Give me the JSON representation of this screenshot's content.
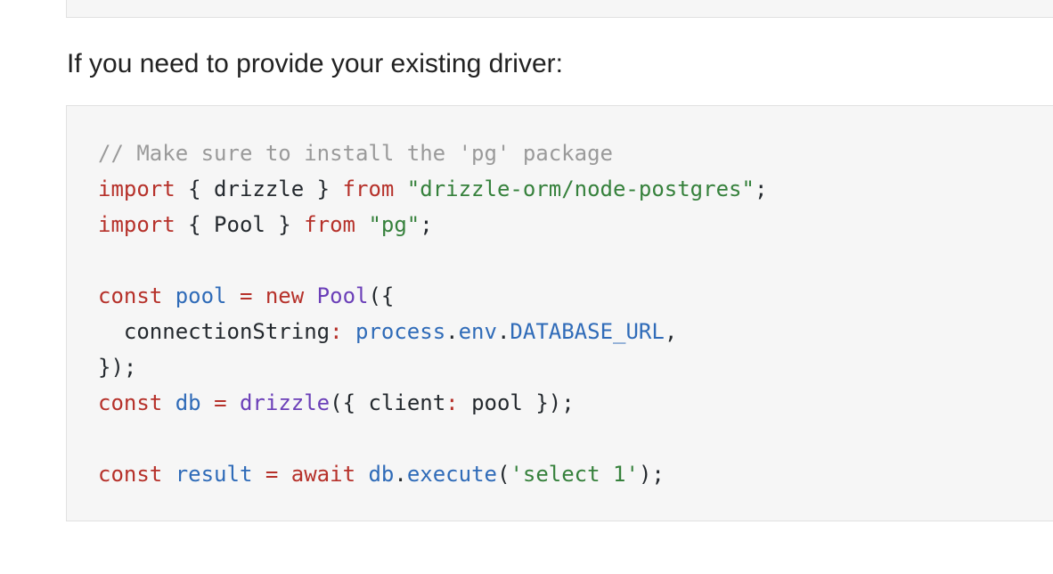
{
  "paragraph": {
    "text": "If you need to provide your existing driver:"
  },
  "colors": {
    "keyword": "#b6312a",
    "string": "#36813c",
    "variable": "#2f6bb8",
    "function": "#6b3fb8",
    "comment": "#9a9a9a",
    "plain": "#24292e",
    "code_background": "#f6f6f6"
  },
  "code": {
    "lines": [
      [
        {
          "t": "comment",
          "v": "// Make sure to install the 'pg' package"
        }
      ],
      [
        {
          "t": "kw",
          "v": "import"
        },
        {
          "t": "plain",
          "v": " { drizzle } "
        },
        {
          "t": "kw",
          "v": "from"
        },
        {
          "t": "plain",
          "v": " "
        },
        {
          "t": "str",
          "v": "\"drizzle-orm/node-postgres\""
        },
        {
          "t": "plain",
          "v": ";"
        }
      ],
      [
        {
          "t": "kw",
          "v": "import"
        },
        {
          "t": "plain",
          "v": " { Pool } "
        },
        {
          "t": "kw",
          "v": "from"
        },
        {
          "t": "plain",
          "v": " "
        },
        {
          "t": "str",
          "v": "\"pg\""
        },
        {
          "t": "plain",
          "v": ";"
        }
      ],
      [
        {
          "t": "plain",
          "v": ""
        }
      ],
      [
        {
          "t": "kw",
          "v": "const"
        },
        {
          "t": "plain",
          "v": " "
        },
        {
          "t": "var",
          "v": "pool"
        },
        {
          "t": "plain",
          "v": " "
        },
        {
          "t": "op",
          "v": "="
        },
        {
          "t": "plain",
          "v": " "
        },
        {
          "t": "kw",
          "v": "new"
        },
        {
          "t": "plain",
          "v": " "
        },
        {
          "t": "fn",
          "v": "Pool"
        },
        {
          "t": "plain",
          "v": "({"
        }
      ],
      [
        {
          "t": "plain",
          "v": "  connectionString"
        },
        {
          "t": "op",
          "v": ":"
        },
        {
          "t": "plain",
          "v": " "
        },
        {
          "t": "var",
          "v": "process"
        },
        {
          "t": "plain",
          "v": "."
        },
        {
          "t": "var",
          "v": "env"
        },
        {
          "t": "plain",
          "v": "."
        },
        {
          "t": "var",
          "v": "DATABASE_URL"
        },
        {
          "t": "plain",
          "v": ","
        }
      ],
      [
        {
          "t": "plain",
          "v": "});"
        }
      ],
      [
        {
          "t": "kw",
          "v": "const"
        },
        {
          "t": "plain",
          "v": " "
        },
        {
          "t": "var",
          "v": "db"
        },
        {
          "t": "plain",
          "v": " "
        },
        {
          "t": "op",
          "v": "="
        },
        {
          "t": "plain",
          "v": " "
        },
        {
          "t": "fn",
          "v": "drizzle"
        },
        {
          "t": "plain",
          "v": "({ client"
        },
        {
          "t": "op",
          "v": ":"
        },
        {
          "t": "plain",
          "v": " pool });"
        }
      ],
      [
        {
          "t": "plain",
          "v": ""
        }
      ],
      [
        {
          "t": "kw",
          "v": "const"
        },
        {
          "t": "plain",
          "v": " "
        },
        {
          "t": "var",
          "v": "result"
        },
        {
          "t": "plain",
          "v": " "
        },
        {
          "t": "op",
          "v": "="
        },
        {
          "t": "plain",
          "v": " "
        },
        {
          "t": "kw",
          "v": "await"
        },
        {
          "t": "plain",
          "v": " "
        },
        {
          "t": "var",
          "v": "db"
        },
        {
          "t": "plain",
          "v": "."
        },
        {
          "t": "var",
          "v": "execute"
        },
        {
          "t": "plain",
          "v": "("
        },
        {
          "t": "str",
          "v": "'select 1'"
        },
        {
          "t": "plain",
          "v": ");"
        }
      ]
    ]
  }
}
